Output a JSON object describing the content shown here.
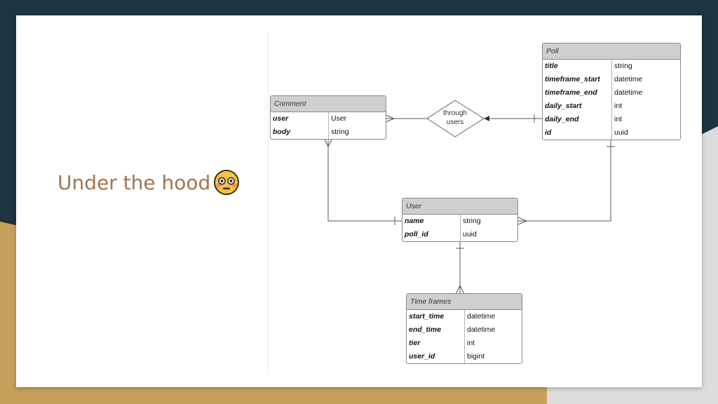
{
  "slide": {
    "title": "Under the hood",
    "title_emoji": "flushed-face-emoji",
    "title_color": "#a4744c",
    "background": "#1e3440",
    "accent": "#c6a15b"
  },
  "diagram": {
    "relationship_label_line1": "through",
    "relationship_label_line2": "users",
    "entities": {
      "poll": {
        "name": "Poll",
        "fields": [
          {
            "name": "title",
            "type": "string"
          },
          {
            "name": "timeframe_start",
            "type": "datetime"
          },
          {
            "name": "timeframe_end",
            "type": "datetime"
          },
          {
            "name": "daily_start",
            "type": "int"
          },
          {
            "name": "daily_end",
            "type": "int"
          },
          {
            "name": "id",
            "type": "uuid"
          }
        ]
      },
      "comment": {
        "name": "Comment",
        "fields": [
          {
            "name": "user",
            "type": "User"
          },
          {
            "name": "body",
            "type": "string"
          }
        ]
      },
      "user": {
        "name": "User",
        "fields": [
          {
            "name": "name",
            "type": "string"
          },
          {
            "name": "poll_id",
            "type": "uuid"
          }
        ]
      },
      "timeframes": {
        "name": "Time frames",
        "fields": [
          {
            "name": "start_time",
            "type": "datetime"
          },
          {
            "name": "end_time",
            "type": "datetime"
          },
          {
            "name": "tier",
            "type": "int"
          },
          {
            "name": "user_id",
            "type": "bigint"
          }
        ]
      }
    }
  }
}
